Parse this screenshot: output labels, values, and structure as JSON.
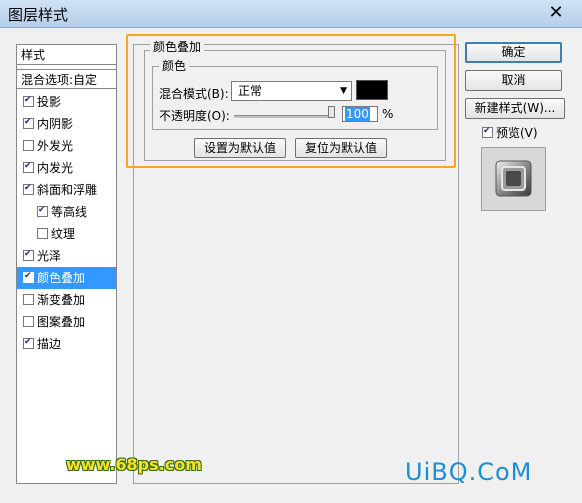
{
  "window": {
    "title": "图层样式",
    "close": "✕"
  },
  "style_list": {
    "header": "样式",
    "blend_options": "混合选项:自定",
    "items": [
      {
        "label": "投影",
        "checked": true
      },
      {
        "label": "内阴影",
        "checked": true
      },
      {
        "label": "外发光",
        "checked": false
      },
      {
        "label": "内发光",
        "checked": true
      },
      {
        "label": "斜面和浮雕",
        "checked": true
      },
      {
        "label": "等高线",
        "checked": true
      },
      {
        "label": "纹理",
        "checked": false
      },
      {
        "label": "光泽",
        "checked": true
      },
      {
        "label": "颜色叠加",
        "checked": true,
        "selected": true
      },
      {
        "label": "渐变叠加",
        "checked": false
      },
      {
        "label": "图案叠加",
        "checked": false
      },
      {
        "label": "描边",
        "checked": true
      }
    ]
  },
  "color_overlay": {
    "group_title": "颜色叠加",
    "subgroup_title": "颜色",
    "blend_mode_label": "混合模式(B):",
    "blend_mode_value": "正常",
    "overlay_color": "#000000",
    "opacity_label": "不透明度(O):",
    "opacity_value": "100",
    "opacity_unit": "%",
    "set_default": "设置为默认值",
    "reset_default": "复位为默认值"
  },
  "right_panel": {
    "ok": "确定",
    "cancel": "取消",
    "new_style": "新建样式(W)...",
    "preview_label": "预览(V)",
    "preview_checked": true
  },
  "watermarks": {
    "left": "www.68ps.com",
    "right": "UiBQ.CoM"
  }
}
